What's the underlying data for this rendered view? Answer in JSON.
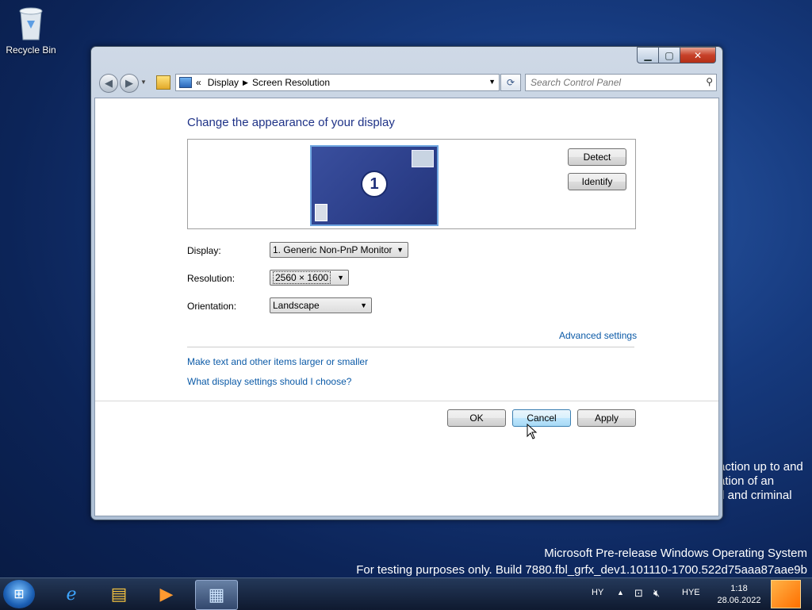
{
  "desktop": {
    "recycle_bin_label": "Recycle Bin",
    "background_text": [
      "action up to and",
      "ation of an",
      "/l and criminal"
    ],
    "watermark_line1": "Microsoft Pre-release Windows Operating System",
    "watermark_line2": "For testing purposes only. Build 7880.fbl_grfx_dev1.101110-1700.522d75aaa87aae9b"
  },
  "window": {
    "address": {
      "chevron": "«",
      "crumbs": [
        "Display",
        "Screen Resolution"
      ]
    },
    "search_placeholder": "Search Control Panel",
    "title": "Change the appearance of your display",
    "monitor_number": "1",
    "detect_label": "Detect",
    "identify_label": "Identify",
    "display_label": "Display:",
    "display_value": "1. Generic Non-PnP Monitor",
    "resolution_label": "Resolution:",
    "resolution_value": "2560 × 1600",
    "orientation_label": "Orientation:",
    "orientation_value": "Landscape",
    "advanced_link": "Advanced settings",
    "link_text_size": "Make text and other items larger or smaller",
    "link_what_settings": "What display settings should I choose?",
    "ok_label": "OK",
    "cancel_label": "Cancel",
    "apply_label": "Apply"
  },
  "taskbar": {
    "language": "HY",
    "keyboard": "HYE",
    "time": "1:18",
    "date": "28.06.2022"
  },
  "colors": {
    "link": "#0b5aa7",
    "title": "#1e3287",
    "monitor": "#2c3f8a"
  }
}
